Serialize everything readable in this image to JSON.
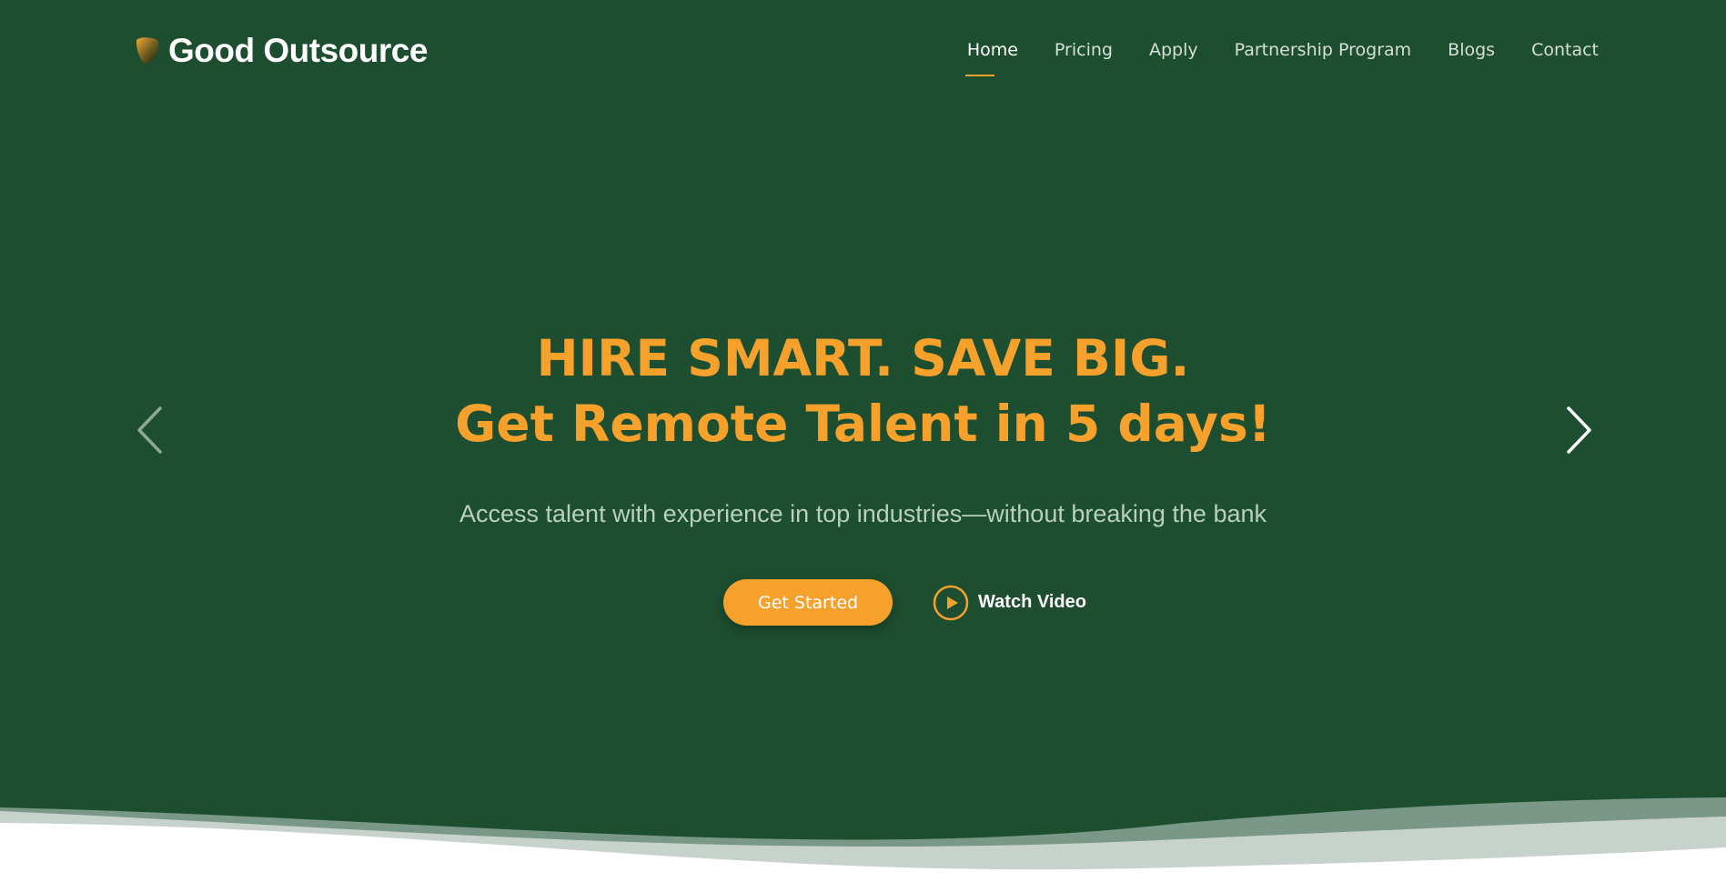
{
  "header": {
    "logo_text": "Good Outsource",
    "nav": [
      {
        "label": "Home",
        "active": true
      },
      {
        "label": "Pricing"
      },
      {
        "label": "Apply"
      },
      {
        "label": "Partnership Program"
      },
      {
        "label": "Blogs"
      },
      {
        "label": "Contact"
      }
    ]
  },
  "hero": {
    "headline_line1": "HIRE SMART. SAVE BIG.",
    "headline_line2": "Get Remote Talent in 5 days!",
    "subtitle": "Access talent with experience in top industries—without breaking the bank",
    "cta_label": "Get Started",
    "video_label": "Watch Video"
  },
  "icons": {
    "logo": "logo-icon",
    "prev": "chevron-left-icon",
    "next": "chevron-right-icon",
    "play": "play-circle-icon"
  },
  "colors": {
    "background": "#1d4e30",
    "accent": "#f7a12d",
    "text_light": "#ffffff",
    "subtitle": "#b9cfc0"
  }
}
